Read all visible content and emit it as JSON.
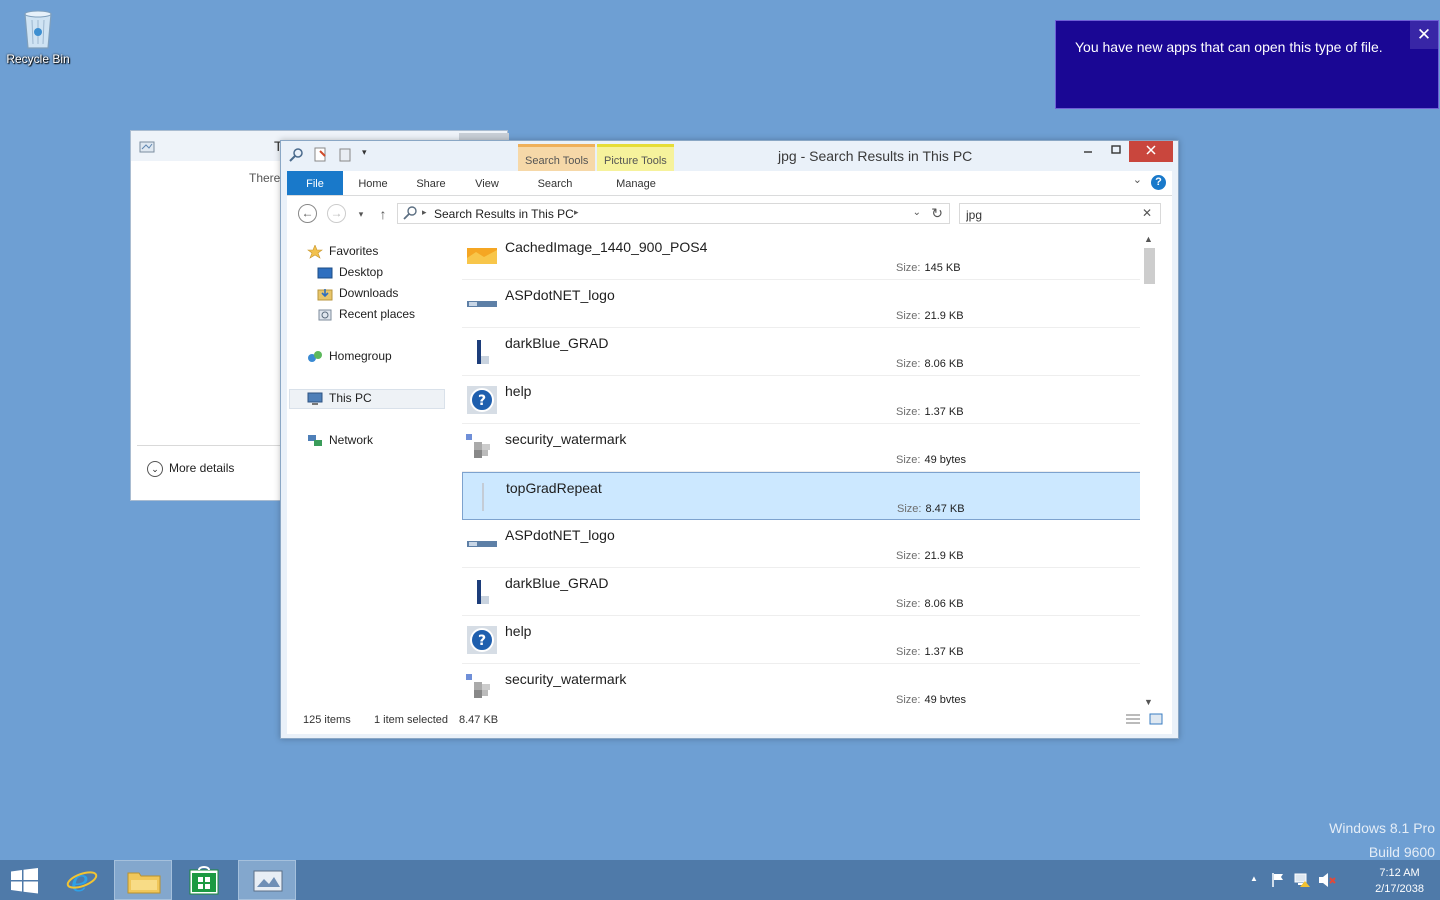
{
  "desktop": {
    "recycle_bin_label": "Recycle Bin",
    "watermark_line1": "Windows 8.1 Pro",
    "watermark_line2": "Build 9600"
  },
  "toast": {
    "message": "You have new apps that can open this type of file.",
    "close_glyph": "✕"
  },
  "bg_window": {
    "title_fragment": "T",
    "body_fragment": "There",
    "more_details_label": "More details"
  },
  "explorer": {
    "title": "jpg - Search Results in This PC",
    "context_tabs": {
      "search_tools": "Search Tools",
      "picture_tools": "Picture Tools"
    },
    "ribbon_tabs": {
      "file": "File",
      "home": "Home",
      "share": "Share",
      "view": "View",
      "search": "Search",
      "manage": "Manage"
    },
    "address": {
      "crumb": "Search Results in This PC"
    },
    "search": {
      "value": "jpg"
    },
    "nav": {
      "favorites": "Favorites",
      "desktop": "Desktop",
      "downloads": "Downloads",
      "recent_places": "Recent places",
      "homegroup": "Homegroup",
      "this_pc": "This PC",
      "network": "Network"
    },
    "size_label": "Size:",
    "files": [
      {
        "name": "CachedImage_1440_900_POS4",
        "size": "145 KB",
        "icon": "wallpaper-thumb-icon"
      },
      {
        "name": "ASPdotNET_logo",
        "size": "21.9 KB",
        "icon": "aspnet-logo-thumb-icon"
      },
      {
        "name": "darkBlue_GRAD",
        "size": "8.06 KB",
        "icon": "gradient-thumb-icon"
      },
      {
        "name": "help",
        "size": "1.37 KB",
        "icon": "help-thumb-icon"
      },
      {
        "name": "security_watermark",
        "size": "49 bytes",
        "icon": "watermark-thumb-icon"
      },
      {
        "name": "topGradRepeat",
        "size": "8.47 KB",
        "icon": "gradient-strip-thumb-icon",
        "selected": true
      },
      {
        "name": "ASPdotNET_logo",
        "size": "21.9 KB",
        "icon": "aspnet-logo-thumb-icon"
      },
      {
        "name": "darkBlue_GRAD",
        "size": "8.06 KB",
        "icon": "gradient-thumb-icon"
      },
      {
        "name": "help",
        "size": "1.37 KB",
        "icon": "help-thumb-icon"
      },
      {
        "name": "security_watermark",
        "size": "49 bvtes",
        "icon": "watermark-thumb-icon"
      }
    ],
    "status": {
      "items": "125 items",
      "selected": "1 item selected",
      "selected_size": "8.47 KB"
    }
  },
  "taskbar": {
    "clock_time": "7:12 AM",
    "clock_date": "2/17/2038"
  },
  "colors": {
    "desktop_bg": "#6e9fd3",
    "toast_bg": "#1a0794",
    "ribbon_file_tab": "#1979ca",
    "selection": "#cce8ff",
    "close_button": "#c9463d",
    "taskbar": "#4f7aa9"
  }
}
